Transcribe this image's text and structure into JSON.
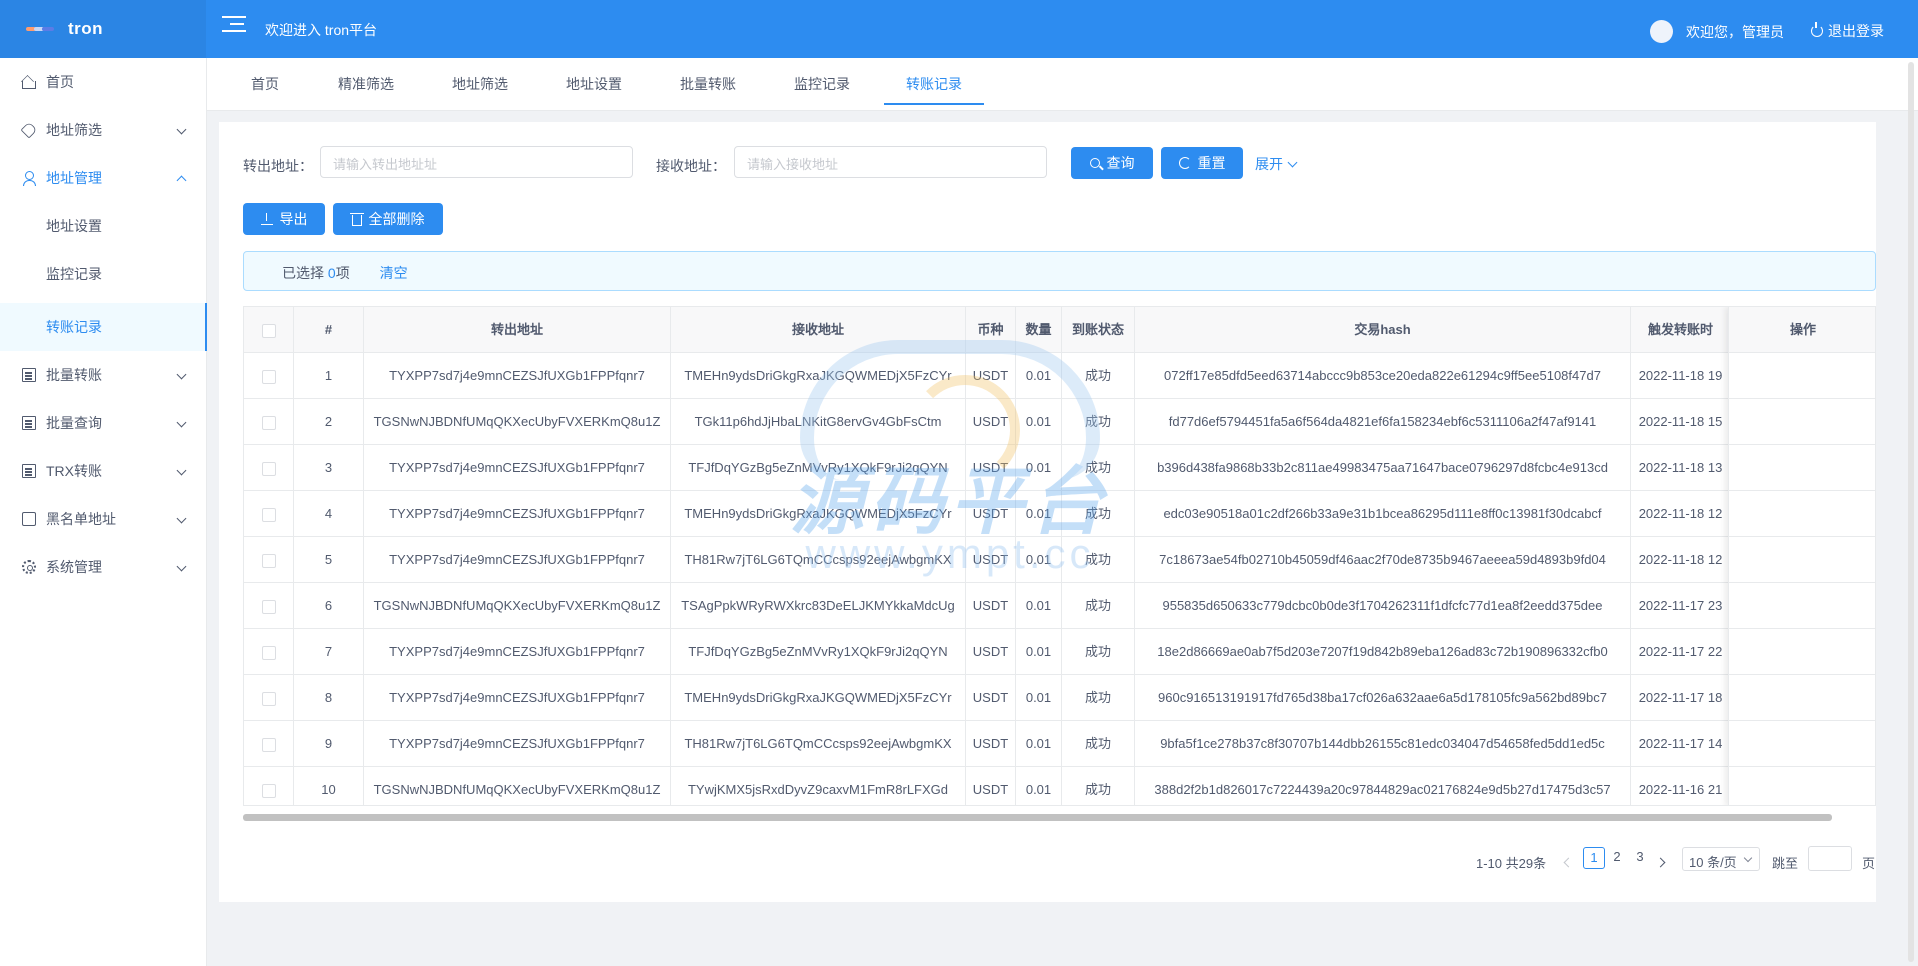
{
  "header": {
    "logo_text": "tron",
    "welcome": "欢迎进入 tron平台",
    "greeting": "欢迎您，管理员",
    "logout": "退出登录"
  },
  "sidebar": {
    "items": [
      {
        "label": "首页",
        "icon": "home-icon"
      },
      {
        "label": "地址筛选",
        "icon": "tag-icon"
      },
      {
        "label": "地址管理",
        "icon": "user-icon"
      },
      {
        "label": "地址设置"
      },
      {
        "label": "监控记录"
      },
      {
        "label": "转账记录"
      },
      {
        "label": "批量转账",
        "icon": "list-icon"
      },
      {
        "label": "批量查询",
        "icon": "list-icon"
      },
      {
        "label": "TRX转账",
        "icon": "list-icon"
      },
      {
        "label": "黑名单地址",
        "icon": "square-icon"
      },
      {
        "label": "系统管理",
        "icon": "gear-icon"
      }
    ]
  },
  "tabs": [
    "首页",
    "精准筛选",
    "地址筛选",
    "地址设置",
    "批量转账",
    "监控记录",
    "转账记录"
  ],
  "filters": {
    "from_label": "转出地址：",
    "from_placeholder": "请输入转出地址址",
    "to_label": "接收地址：",
    "to_placeholder": "请输入接收地址",
    "search": "查询",
    "reset": "重置",
    "expand": "展开"
  },
  "actions": {
    "export": "导出",
    "delete_all": "全部删除"
  },
  "selection": {
    "prefix": "已选择",
    "count": "0",
    "suffix": "项",
    "clear": "清空"
  },
  "table": {
    "columns": [
      "#",
      "转出地址",
      "接收地址",
      "币种",
      "数量",
      "到账状态",
      "交易hash",
      "触发转账时",
      "操作"
    ],
    "rows": [
      [
        "1",
        "TYXPP7sd7j4e9mnCEZSJfUXGb1FPPfqnr7",
        "TMEHn9ydsDriGkgRxaJKGQWMEDjX5FzCYr",
        "USDT",
        "0.01",
        "成功",
        "072ff17e85dfd5eed63714abccc9b853ce20eda822e61294c9ff5ee5108f47d7",
        "2022-11-18 19"
      ],
      [
        "2",
        "TGSNwNJBDNfUMqQKXecUbyFVXERKmQ8u1Z",
        "TGk11p6hdJjHbaLNKitG8ervGv4GbFsCtm",
        "USDT",
        "0.01",
        "成功",
        "fd77d6ef5794451fa5a6f564da4821ef6fa158234ebf6c5311106a2f47af9141",
        "2022-11-18 15"
      ],
      [
        "3",
        "TYXPP7sd7j4e9mnCEZSJfUXGb1FPPfqnr7",
        "TFJfDqYGzBg5eZnMVvRy1XQkF9rJi2qQYN",
        "USDT",
        "0.01",
        "成功",
        "b396d438fa9868b33b2c811ae49983475aa71647bace0796297d8fcbc4e913cd",
        "2022-11-18 13"
      ],
      [
        "4",
        "TYXPP7sd7j4e9mnCEZSJfUXGb1FPPfqnr7",
        "TMEHn9ydsDriGkgRxaJKGQWMEDjX5FzCYr",
        "USDT",
        "0.01",
        "成功",
        "edc03e90518a01c2df266b33a9e31b1bcea86295d111e8ff0c13981f30dcabcf",
        "2022-11-18 12"
      ],
      [
        "5",
        "TYXPP7sd7j4e9mnCEZSJfUXGb1FPPfqnr7",
        "TH81Rw7jT6LG6TQmCCcsps92eejAwbgmKX",
        "USDT",
        "0.01",
        "成功",
        "7c18673ae54fb02710b45059df46aac2f70de8735b9467aeeea59d4893b9fd04",
        "2022-11-18 12"
      ],
      [
        "6",
        "TGSNwNJBDNfUMqQKXecUbyFVXERKmQ8u1Z",
        "TSAgPpkWRyRWXkrc83DeELJKMYkkaMdcUg",
        "USDT",
        "0.01",
        "成功",
        "955835d650633c779dcbc0b0de3f1704262311f1dfcfc77d1ea8f2eedd375dee",
        "2022-11-17 23"
      ],
      [
        "7",
        "TYXPP7sd7j4e9mnCEZSJfUXGb1FPPfqnr7",
        "TFJfDqYGzBg5eZnMVvRy1XQkF9rJi2qQYN",
        "USDT",
        "0.01",
        "成功",
        "18e2d86669ae0ab7f5d203e7207f19d842b89eba126ad83c72b190896332cfb0",
        "2022-11-17 22"
      ],
      [
        "8",
        "TYXPP7sd7j4e9mnCEZSJfUXGb1FPPfqnr7",
        "TMEHn9ydsDriGkgRxaJKGQWMEDjX5FzCYr",
        "USDT",
        "0.01",
        "成功",
        "960c916513191917fd765d38ba17cf026a632aae6a5d178105fc9a562bd89bc7",
        "2022-11-17 18"
      ],
      [
        "9",
        "TYXPP7sd7j4e9mnCEZSJfUXGb1FPPfqnr7",
        "TH81Rw7jT6LG6TQmCCcsps92eejAwbgmKX",
        "USDT",
        "0.01",
        "成功",
        "9bfa5f1ce278b37c8f30707b144dbb26155c81edc034047d54658fed5dd1ed5c",
        "2022-11-17 14"
      ],
      [
        "10",
        "TGSNwNJBDNfUMqQKXecUbyFVXERKmQ8u1Z",
        "TYwjKMX5jsRxdDyvZ9caxvM1FmR8rLFXGd",
        "USDT",
        "0.01",
        "成功",
        "388d2f2b1d826017c7224439a20c97844829ac02176824e9d5b27d17475d3c57",
        "2022-11-16 21"
      ]
    ]
  },
  "watermark": {
    "text": "源码平台",
    "url": "www.ympt.cc"
  },
  "pagination": {
    "total": "1-10 共29条",
    "pages": [
      "1",
      "2",
      "3"
    ],
    "current": "1",
    "page_size": "10 条/页",
    "jump_label": "跳至",
    "page_unit": "页"
  },
  "colors": {
    "primary": "#2d8cf0",
    "header": "#2d8cf0",
    "alert_bg": "#f0faff"
  }
}
